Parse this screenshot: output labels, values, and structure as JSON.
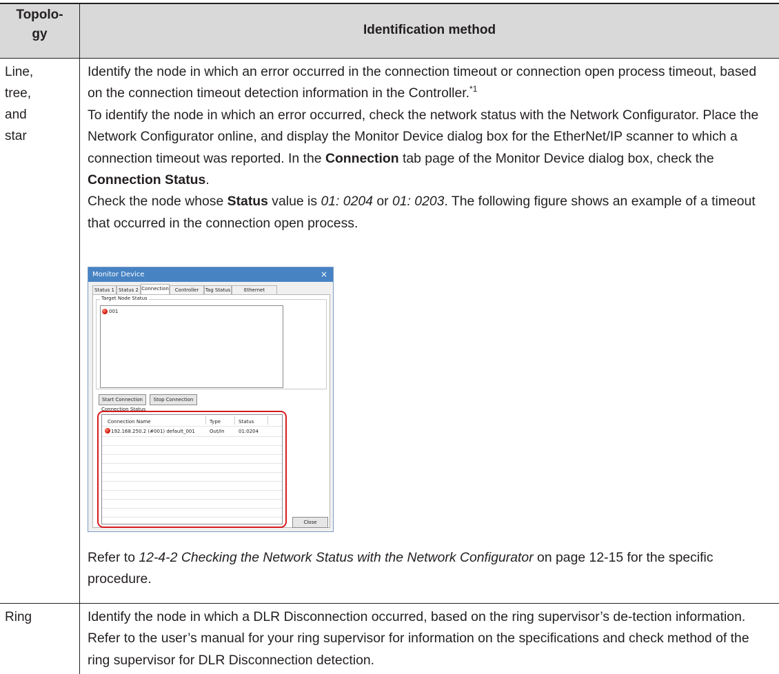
{
  "header": {
    "topology_label": "Topolo-\ngy",
    "method_label": "Identification method"
  },
  "rows": [
    {
      "topology": "Line,\ntree,\nand\nstar",
      "intro_text": "Identify the node in which an error occurred in the connection timeout or connection open process timeout, based on the connection timeout detection information in the Controller.",
      "intro_footnote": "*1",
      "check_text_1": "To identify the node in which an error occurred, check the network status with the Network Configurator. Place the Network Configurator online, and display the Monitor Device dialog box for the EtherNet/IP scanner to which a connection timeout was reported. In the ",
      "bold_connection": "Connection",
      "check_text_2": " tab page of the Monitor Device dialog box, check the ",
      "bold_connection_status": "Connection Status",
      "check_text_3": ".",
      "check_text_4": "Check the node whose ",
      "bold_status": "Status",
      "check_text_5": " value is ",
      "italic_code_1": "01: 0204",
      "check_text_6": " or ",
      "italic_code_2": "01: 0203",
      "check_text_7": ". The following figure shows an example of a timeout that occurred in the connection open process.",
      "refer_text_1": "Refer to ",
      "refer_italic": "12-4-2 Checking the Network Status with the Network Configurator",
      "refer_text_2": " on page 12-15 for the specific procedure."
    },
    {
      "topology": "Ring",
      "text": "Identify the node in which a DLR Disconnection occurred, based on the ring supervisor’s de-tection information. Refer to the user’s manual for your ring supervisor for information on the specifications and check method of the ring supervisor for DLR Disconnection detection."
    }
  ],
  "dialog": {
    "title": "Monitor Device",
    "close_glyph": "×",
    "tabs": [
      "Status 1",
      "Status 2",
      "Connection",
      "Controller Log",
      "Tag Status",
      "Ethernet Information"
    ],
    "active_tab": "Connection",
    "target_group_label": "Target Node Status",
    "target_node": "001",
    "start_button": "Start Connection",
    "stop_button": "Stop Connection",
    "conn_group_label": "Connection Status",
    "columns": [
      "Connection Name",
      "Type",
      "Status"
    ],
    "connections": [
      {
        "name": "192.168.250.2 (#001) default_001",
        "type": "Out/In",
        "status": "01:0204"
      }
    ],
    "close_button": "Close",
    "status_color": "#d31c0e"
  }
}
